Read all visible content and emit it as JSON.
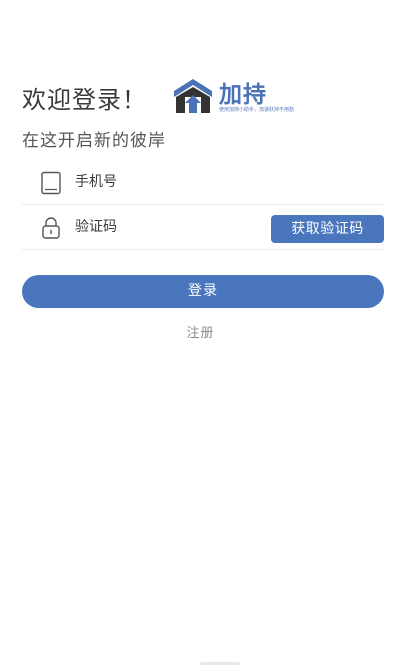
{
  "header": {
    "welcome_text": "欢迎登录！",
    "subtitle": "在这开启新的彼岸"
  },
  "logo": {
    "name": "加持",
    "slogan": "使用加持小助手，加速跃持不用愁",
    "colors": {
      "mark_dark": "#333333",
      "mark_blue": "#4a72b6"
    }
  },
  "form": {
    "phone": {
      "placeholder": "手机号",
      "icon": "tablet-icon"
    },
    "code": {
      "placeholder": "验证码",
      "icon": "lock-icon",
      "get_code_label": "获取验证码"
    },
    "login_label": "登录",
    "register_label": "注册"
  },
  "theme": {
    "accent": "#4a76bd",
    "divider": "#ececec",
    "muted_text": "#8a8a8a"
  }
}
